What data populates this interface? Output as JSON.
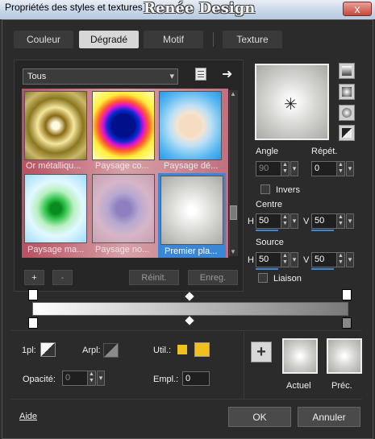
{
  "window": {
    "title": "Propriétés des styles et textures",
    "watermark": "Renée Design",
    "close": "x"
  },
  "tabs": [
    {
      "label": "Couleur"
    },
    {
      "label": "Dégradé"
    },
    {
      "label": "Motif"
    },
    {
      "label": "Texture"
    }
  ],
  "filter": {
    "value": "Tous"
  },
  "thumbnails": [
    {
      "label": "Or métalliqu..."
    },
    {
      "label": "Paysage co..."
    },
    {
      "label": "Paysage dé..."
    },
    {
      "label": "Paysage ma..."
    },
    {
      "label": "Paysage no..."
    },
    {
      "label": "Premier pla..."
    }
  ],
  "list_buttons": {
    "add": "+",
    "remove": "-",
    "reset": "Réinit.",
    "save": "Enreg."
  },
  "angle": {
    "label": "Angle",
    "value": "90"
  },
  "repeat": {
    "label": "Répét.",
    "value": "0"
  },
  "invert": {
    "label": "Invers"
  },
  "center": {
    "label": "Centre",
    "h_label": "H",
    "h_value": "50",
    "v_label": "V",
    "v_value": "50"
  },
  "source": {
    "label": "Source",
    "h_label": "H",
    "h_value": "50",
    "v_label": "V",
    "v_value": "50"
  },
  "link": {
    "label": "Liaison"
  },
  "bottom": {
    "loc_label": "1pl:",
    "arpl_label": "Arpl:",
    "util_label": "Util.:",
    "opacity_label": "Opacité:",
    "opacity_value": "0",
    "empl_label": "Empl.:",
    "empl_value": "0",
    "plus": "+",
    "current_label": "Actuel",
    "previous_label": "Préc."
  },
  "footer": {
    "help": "Aide",
    "ok": "OK",
    "cancel": "Annuler"
  },
  "colors": {
    "accent": "#3a86d8",
    "swatch": "#f0c020"
  }
}
